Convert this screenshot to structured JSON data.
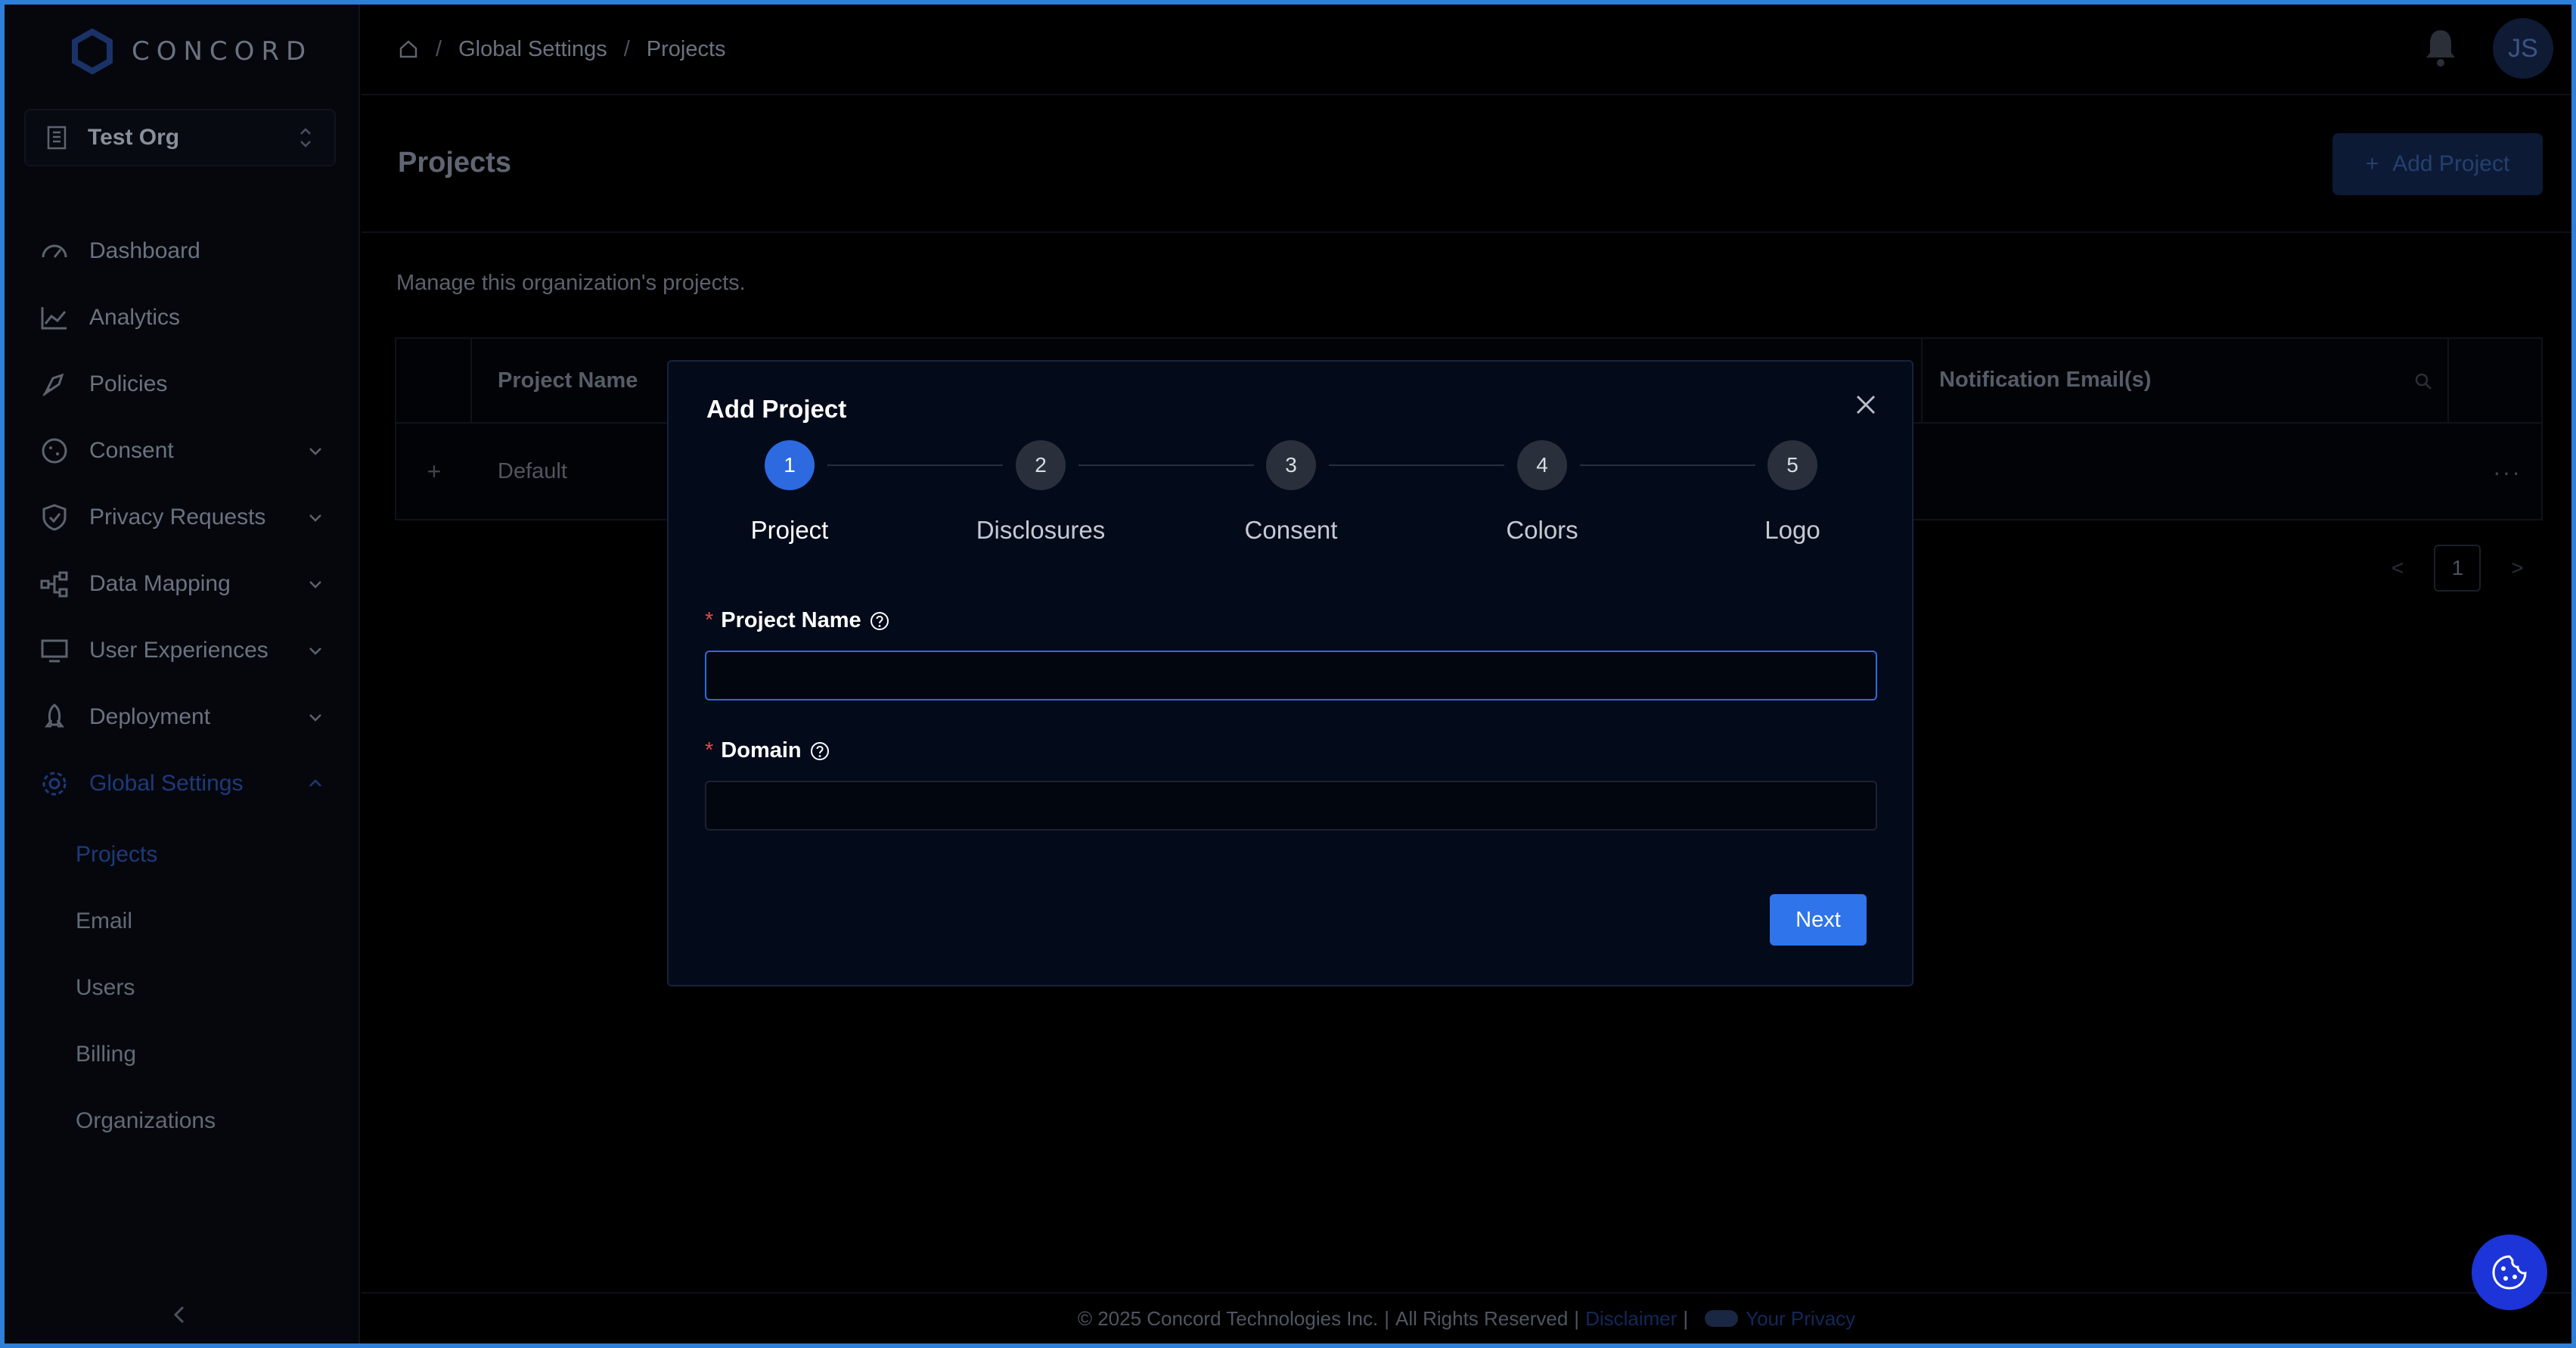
{
  "app": {
    "brand": "CONCORD"
  },
  "org_selector": {
    "name": "Test Org"
  },
  "sidebar": {
    "items": [
      {
        "label": "Dashboard",
        "icon": "dashboard-icon",
        "expandable": false
      },
      {
        "label": "Analytics",
        "icon": "analytics-icon",
        "expandable": false
      },
      {
        "label": "Policies",
        "icon": "policies-icon",
        "expandable": false
      },
      {
        "label": "Consent",
        "icon": "consent-icon",
        "expandable": true
      },
      {
        "label": "Privacy Requests",
        "icon": "shield-icon",
        "expandable": true
      },
      {
        "label": "Data Mapping",
        "icon": "data-mapping-icon",
        "expandable": true
      },
      {
        "label": "User Experiences",
        "icon": "monitor-icon",
        "expandable": true
      },
      {
        "label": "Deployment",
        "icon": "rocket-icon",
        "expandable": true
      },
      {
        "label": "Global Settings",
        "icon": "gear-icon",
        "expandable": true,
        "active": true
      }
    ],
    "sub_items": [
      {
        "label": "Projects",
        "active": true
      },
      {
        "label": "Email"
      },
      {
        "label": "Users"
      },
      {
        "label": "Billing"
      },
      {
        "label": "Organizations"
      }
    ]
  },
  "header": {
    "breadcrumb": [
      "Global Settings",
      "Projects"
    ],
    "avatar_initials": "JS"
  },
  "page": {
    "title": "Projects",
    "add_button": "Add Project",
    "description": "Manage this organization's projects."
  },
  "table": {
    "columns": [
      "Project Name",
      "Notification Email(s)"
    ],
    "rows": [
      {
        "expand": "+",
        "name": "Default",
        "actions": "···"
      }
    ]
  },
  "pagination": {
    "current_page": "1",
    "prev": "<",
    "next": ">"
  },
  "footer": {
    "copyright": "© 2025 Concord Technologies Inc.",
    "rights": "All Rights Reserved",
    "disclaimer": "Disclaimer",
    "privacy": "Your Privacy"
  },
  "modal": {
    "title": "Add Project",
    "steps": [
      {
        "number": "1",
        "label": "Project",
        "active": true
      },
      {
        "number": "2",
        "label": "Disclosures"
      },
      {
        "number": "3",
        "label": "Consent"
      },
      {
        "number": "4",
        "label": "Colors"
      },
      {
        "number": "5",
        "label": "Logo"
      }
    ],
    "fields": {
      "project_name": {
        "label": "Project Name",
        "required": "*",
        "value": ""
      },
      "domain": {
        "label": "Domain",
        "required": "*",
        "value": ""
      }
    },
    "next_button": "Next"
  },
  "colors": {
    "accent": "#2f74ea",
    "frame": "#2e7fd9",
    "cookie_button": "#1c34d8",
    "required": "#e24b4b"
  }
}
